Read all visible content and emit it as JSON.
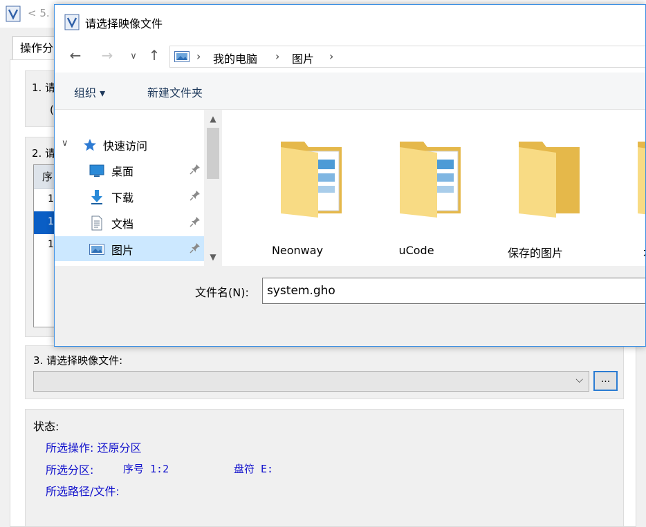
{
  "app": {
    "title_text": "< 5.",
    "tab_label": "操作分",
    "step1_label": "1. 请",
    "step1_sub": "(",
    "step2_label": "2. 请",
    "table_header": "序",
    "table_rows": [
      "1",
      "1",
      "1"
    ],
    "step3_label": "3. 请选择映像文件:",
    "browse_label": "...",
    "status": {
      "title": "状态:",
      "operation": "所选操作: 还原分区",
      "partition_label": "所选分区:",
      "partition_no": "序号 1:2",
      "drive_letter": "盘符 E:",
      "path_label": "所选路径/文件:"
    }
  },
  "dialog": {
    "title": "请选择映像文件",
    "breadcrumb": [
      "我的电脑",
      "图片"
    ],
    "toolbar": {
      "organize": "组织 ▾",
      "new_folder": "新建文件夹"
    },
    "nav_pane": {
      "quick_access": "快速访问",
      "items": [
        {
          "label": "桌面",
          "icon": "desktop-icon"
        },
        {
          "label": "下载",
          "icon": "download-icon"
        },
        {
          "label": "文档",
          "icon": "document-icon"
        },
        {
          "label": "图片",
          "icon": "pictures-icon"
        }
      ]
    },
    "files": [
      {
        "label": "Neonway"
      },
      {
        "label": "uCode"
      },
      {
        "label": "保存的图片"
      },
      {
        "label": "本机"
      }
    ],
    "filename_label": "文件名(N):",
    "filename_value": "system.gho"
  },
  "colors": {
    "accent": "#0a5ec5",
    "status_text": "#1111cc",
    "selection": "#cce8ff",
    "folder": "#f5d77a"
  }
}
